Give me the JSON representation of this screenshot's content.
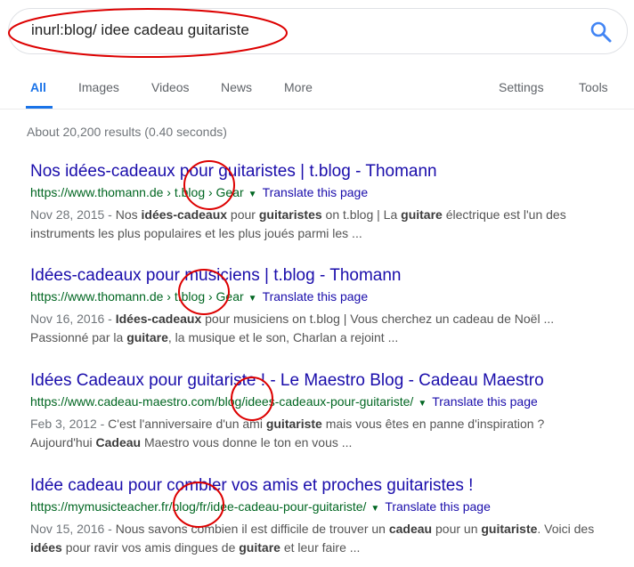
{
  "search": {
    "query": "inurl:blog/ idee cadeau guitariste",
    "search_icon": "search-icon"
  },
  "tabs": {
    "all": "All",
    "images": "Images",
    "videos": "Videos",
    "news": "News",
    "more": "More",
    "settings": "Settings",
    "tools": "Tools"
  },
  "stats": "About 20,200 results (0.40 seconds)",
  "annotation_color": "#dd0000",
  "link_color": "#1a0dab",
  "url_color": "#006621",
  "results": [
    {
      "title": "Nos idées-cadeaux pour guitaristes | t.blog - Thomann",
      "url": "https://www.thomann.de › t.blog › Gear",
      "translate": "Translate this page",
      "date": "Nov 28, 2015 - ",
      "snippet_parts": [
        {
          "t": "Nos "
        },
        {
          "t": "idées-cadeaux",
          "b": true
        },
        {
          "t": " pour "
        },
        {
          "t": "guitaristes",
          "b": true
        },
        {
          "t": " on t.blog | La "
        },
        {
          "t": "guitare",
          "b": true
        },
        {
          "t": " électrique est l'un des instruments les plus populaires et les plus joués parmi les ..."
        }
      ]
    },
    {
      "title": "Idées-cadeaux pour musiciens | t.blog - Thomann",
      "url": "https://www.thomann.de › t.blog › Gear",
      "translate": "Translate this page",
      "date": "Nov 16, 2016 - ",
      "snippet_parts": [
        {
          "t": "Idées-cadeaux",
          "b": true
        },
        {
          "t": " pour musiciens on t.blog | Vous cherchez un cadeau de Noël ... Passionné par la "
        },
        {
          "t": "guitare",
          "b": true
        },
        {
          "t": ", la musique et le son, Charlan a rejoint ..."
        }
      ]
    },
    {
      "title": "Idées Cadeaux pour guitariste ! - Le Maestro Blog - Cadeau Maestro",
      "url": "https://www.cadeau-maestro.com/blog/idees-cadeaux-pour-guitariste/",
      "translate": "Translate this page",
      "date": "Feb 3, 2012 - ",
      "snippet_parts": [
        {
          "t": "C'est l'anniversaire d'un ami "
        },
        {
          "t": "guitariste",
          "b": true
        },
        {
          "t": " mais vous êtes en panne d'inspiration ? Aujourd'hui "
        },
        {
          "t": "Cadeau",
          "b": true
        },
        {
          "t": " Maestro vous donne le ton en vous ..."
        }
      ]
    },
    {
      "title": "Idée cadeau pour combler vos amis et proches guitaristes !",
      "url": "https://mymusicteacher.fr/blog/fr/idee-cadeau-pour-guitariste/",
      "translate": "Translate this page",
      "date": "Nov 15, 2016 - ",
      "snippet_parts": [
        {
          "t": "Nous savons combien il est difficile de trouver un "
        },
        {
          "t": "cadeau",
          "b": true
        },
        {
          "t": " pour un "
        },
        {
          "t": "guitariste",
          "b": true
        },
        {
          "t": ". Voici des "
        },
        {
          "t": "idées",
          "b": true
        },
        {
          "t": " pour ravir vos amis dingues de "
        },
        {
          "t": "guitare",
          "b": true
        },
        {
          "t": " et leur faire ..."
        }
      ]
    }
  ]
}
